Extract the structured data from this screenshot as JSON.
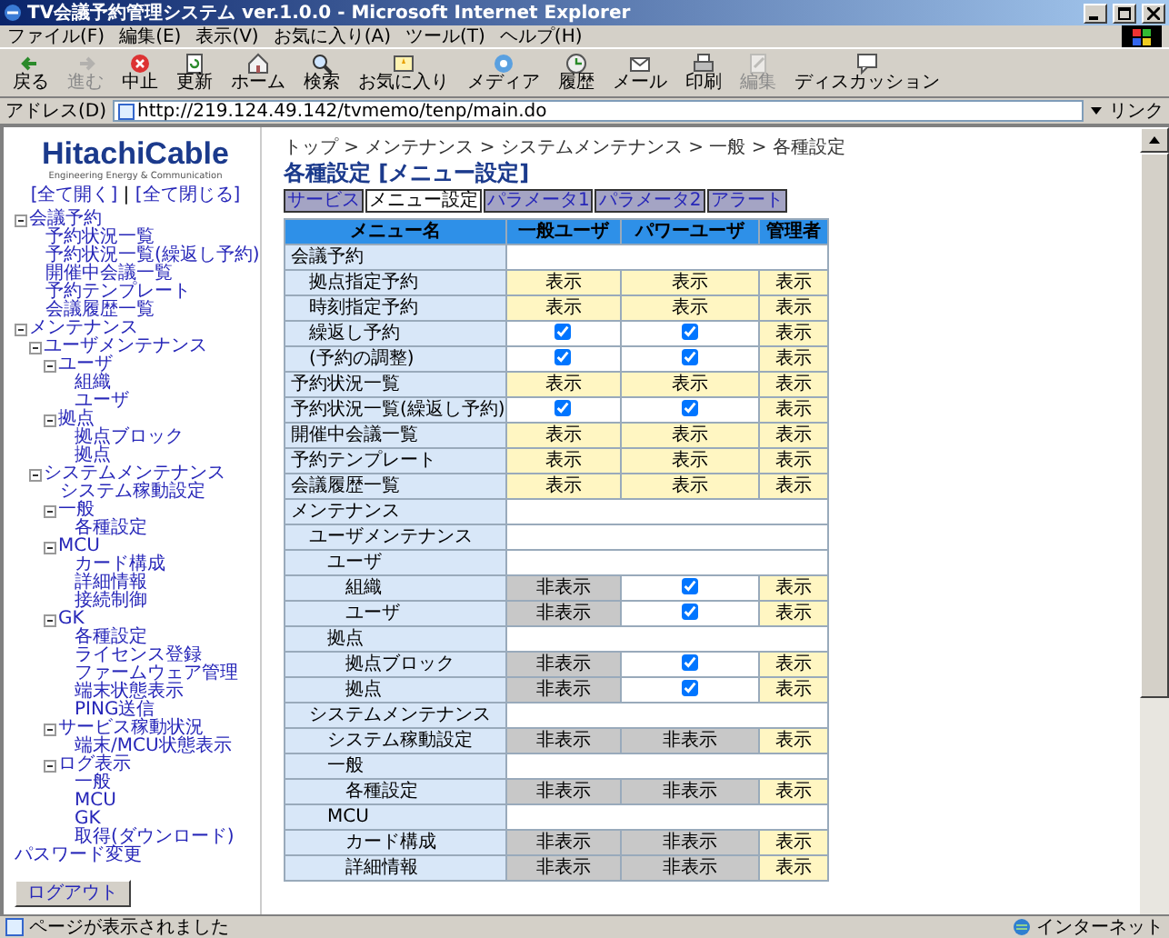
{
  "window": {
    "title": "TV会議予約管理システム ver.1.0.0 - Microsoft Internet Explorer"
  },
  "menu_bar": [
    "ファイル(F)",
    "編集(E)",
    "表示(V)",
    "お気に入り(A)",
    "ツール(T)",
    "ヘルプ(H)"
  ],
  "toolbar": [
    {
      "label": "戻る",
      "kind": "back",
      "disabled": false
    },
    {
      "label": "進む",
      "kind": "forward",
      "disabled": true
    },
    {
      "label": "中止",
      "kind": "stop",
      "disabled": false
    },
    {
      "label": "更新",
      "kind": "refresh",
      "disabled": false
    },
    {
      "label": "ホーム",
      "kind": "home",
      "disabled": false
    },
    {
      "label": "検索",
      "kind": "search",
      "disabled": false
    },
    {
      "label": "お気に入り",
      "kind": "favorites",
      "disabled": false
    },
    {
      "label": "メディア",
      "kind": "media",
      "disabled": false
    },
    {
      "label": "履歴",
      "kind": "history",
      "disabled": false
    },
    {
      "label": "メール",
      "kind": "mail",
      "disabled": false
    },
    {
      "label": "印刷",
      "kind": "print",
      "disabled": false
    },
    {
      "label": "編集",
      "kind": "edit",
      "disabled": true
    },
    {
      "label": "ディスカッション",
      "kind": "discuss",
      "disabled": false
    }
  ],
  "address_bar": {
    "label": "アドレス(D)",
    "url": "http://219.124.49.142/tvmemo/tenp/main.do",
    "links": "リンク"
  },
  "sidebar": {
    "logo": "HitachiCable",
    "tagline": "Engineering Energy & Communication",
    "expand_links": [
      "[全て開く]",
      "[全て閉じる]"
    ],
    "separator": "|",
    "tree": [
      {
        "label": "会議予約",
        "expanded": true,
        "children": [
          {
            "label": "予約状況一覧"
          },
          {
            "label": "予約状況一覧(繰返し予約)"
          },
          {
            "label": "開催中会議一覧"
          },
          {
            "label": "予約テンプレート"
          },
          {
            "label": "会議履歴一覧"
          }
        ]
      },
      {
        "label": "メンテナンス",
        "expanded": true,
        "children": [
          {
            "label": "ユーザメンテナンス",
            "expanded": true,
            "children": [
              {
                "label": "ユーザ",
                "expanded": true,
                "children": [
                  {
                    "label": "組織"
                  },
                  {
                    "label": "ユーザ"
                  }
                ]
              },
              {
                "label": "拠点",
                "expanded": true,
                "children": [
                  {
                    "label": "拠点ブロック"
                  },
                  {
                    "label": "拠点"
                  }
                ]
              }
            ]
          },
          {
            "label": "システムメンテナンス",
            "expanded": true,
            "children": [
              {
                "label": "システム稼動設定"
              },
              {
                "label": "一般",
                "expanded": true,
                "children": [
                  {
                    "label": "各種設定"
                  }
                ]
              },
              {
                "label": "MCU",
                "expanded": true,
                "children": [
                  {
                    "label": "カード構成"
                  },
                  {
                    "label": "詳細情報"
                  },
                  {
                    "label": "接続制御"
                  }
                ]
              },
              {
                "label": "GK",
                "expanded": true,
                "children": [
                  {
                    "label": "各種設定"
                  },
                  {
                    "label": "ライセンス登録"
                  },
                  {
                    "label": "ファームウェア管理"
                  },
                  {
                    "label": "端末状態表示"
                  },
                  {
                    "label": "PING送信"
                  }
                ]
              },
              {
                "label": "サービス稼動状況",
                "expanded": true,
                "children": [
                  {
                    "label": "端末/MCU状態表示"
                  }
                ]
              },
              {
                "label": "ログ表示",
                "expanded": true,
                "children": [
                  {
                    "label": "一般"
                  },
                  {
                    "label": "MCU"
                  },
                  {
                    "label": "GK"
                  },
                  {
                    "label": "取得(ダウンロード)"
                  }
                ]
              }
            ]
          }
        ]
      },
      {
        "label": "パスワード変更"
      }
    ],
    "logout_button": "ログアウト"
  },
  "page": {
    "breadcrumb": "トップ > メンテナンス > システムメンテナンス > 一般 > 各種設定",
    "heading": "各種設定 [メニュー設定]",
    "tabs": [
      {
        "label": "サービス",
        "selected": false
      },
      {
        "label": "メニュー設定",
        "selected": true
      },
      {
        "label": "パラメータ1",
        "selected": false
      },
      {
        "label": "パラメータ2",
        "selected": false
      },
      {
        "label": "アラート",
        "selected": false
      }
    ],
    "table": {
      "columns": [
        "メニュー名",
        "一般ユーザ",
        "パワーユーザ",
        "管理者"
      ],
      "rows": [
        {
          "name": "会議予約",
          "children": [
            {
              "name": "拠点指定予約",
              "cells": [
                {
                  "kind": "shown",
                  "text": "表示"
                },
                {
                  "kind": "shown",
                  "text": "表示"
                },
                {
                  "kind": "shown",
                  "text": "表示"
                }
              ]
            },
            {
              "name": "時刻指定予約",
              "cells": [
                {
                  "kind": "shown",
                  "text": "表示"
                },
                {
                  "kind": "shown",
                  "text": "表示"
                },
                {
                  "kind": "shown",
                  "text": "表示"
                }
              ]
            },
            {
              "name": "繰返し予約",
              "cells": [
                {
                  "kind": "checkbox",
                  "checked": true
                },
                {
                  "kind": "checkbox",
                  "checked": true
                },
                {
                  "kind": "shown",
                  "text": "表示"
                }
              ]
            },
            {
              "name": "(予約の調整)",
              "cells": [
                {
                  "kind": "checkbox",
                  "checked": true
                },
                {
                  "kind": "checkbox",
                  "checked": true
                },
                {
                  "kind": "shown",
                  "text": "表示"
                }
              ]
            }
          ]
        },
        {
          "name": "予約状況一覧",
          "cells": [
            {
              "kind": "shown",
              "text": "表示"
            },
            {
              "kind": "shown",
              "text": "表示"
            },
            {
              "kind": "shown",
              "text": "表示"
            }
          ]
        },
        {
          "name": "予約状況一覧(繰返し予約)",
          "cells": [
            {
              "kind": "checkbox",
              "checked": true
            },
            {
              "kind": "checkbox",
              "checked": true
            },
            {
              "kind": "shown",
              "text": "表示"
            }
          ]
        },
        {
          "name": "開催中会議一覧",
          "cells": [
            {
              "kind": "shown",
              "text": "表示"
            },
            {
              "kind": "shown",
              "text": "表示"
            },
            {
              "kind": "shown",
              "text": "表示"
            }
          ]
        },
        {
          "name": "予約テンプレート",
          "cells": [
            {
              "kind": "shown",
              "text": "表示"
            },
            {
              "kind": "shown",
              "text": "表示"
            },
            {
              "kind": "shown",
              "text": "表示"
            }
          ]
        },
        {
          "name": "会議履歴一覧",
          "cells": [
            {
              "kind": "shown",
              "text": "表示"
            },
            {
              "kind": "shown",
              "text": "表示"
            },
            {
              "kind": "shown",
              "text": "表示"
            }
          ]
        },
        {
          "name": "メンテナンス",
          "children": [
            {
              "name": "ユーザメンテナンス",
              "children": [
                {
                  "name": "ユーザ",
                  "children": [
                    {
                      "name": "組織",
                      "cells": [
                        {
                          "kind": "hidden",
                          "text": "非表示"
                        },
                        {
                          "kind": "checkbox",
                          "checked": true
                        },
                        {
                          "kind": "shown",
                          "text": "表示"
                        }
                      ]
                    },
                    {
                      "name": "ユーザ",
                      "cells": [
                        {
                          "kind": "hidden",
                          "text": "非表示"
                        },
                        {
                          "kind": "checkbox",
                          "checked": true
                        },
                        {
                          "kind": "shown",
                          "text": "表示"
                        }
                      ]
                    }
                  ]
                },
                {
                  "name": "拠点",
                  "children": [
                    {
                      "name": "拠点ブロック",
                      "cells": [
                        {
                          "kind": "hidden",
                          "text": "非表示"
                        },
                        {
                          "kind": "checkbox",
                          "checked": true
                        },
                        {
                          "kind": "shown",
                          "text": "表示"
                        }
                      ]
                    },
                    {
                      "name": "拠点",
                      "cells": [
                        {
                          "kind": "hidden",
                          "text": "非表示"
                        },
                        {
                          "kind": "checkbox",
                          "checked": true
                        },
                        {
                          "kind": "shown",
                          "text": "表示"
                        }
                      ]
                    }
                  ]
                }
              ]
            },
            {
              "name": "システムメンテナンス",
              "children": [
                {
                  "name": "システム稼動設定",
                  "cells": [
                    {
                      "kind": "hidden",
                      "text": "非表示"
                    },
                    {
                      "kind": "hidden",
                      "text": "非表示"
                    },
                    {
                      "kind": "shown",
                      "text": "表示"
                    }
                  ]
                },
                {
                  "name": "一般",
                  "children": [
                    {
                      "name": "各種設定",
                      "cells": [
                        {
                          "kind": "hidden",
                          "text": "非表示"
                        },
                        {
                          "kind": "hidden",
                          "text": "非表示"
                        },
                        {
                          "kind": "shown",
                          "text": "表示"
                        }
                      ]
                    }
                  ]
                },
                {
                  "name": "MCU",
                  "children": [
                    {
                      "name": "カード構成",
                      "cells": [
                        {
                          "kind": "hidden",
                          "text": "非表示"
                        },
                        {
                          "kind": "hidden",
                          "text": "非表示"
                        },
                        {
                          "kind": "shown",
                          "text": "表示"
                        }
                      ]
                    },
                    {
                      "name": "詳細情報",
                      "cells": [
                        {
                          "kind": "hidden",
                          "text": "非表示"
                        },
                        {
                          "kind": "hidden",
                          "text": "非表示"
                        },
                        {
                          "kind": "shown",
                          "text": "表示"
                        }
                      ]
                    }
                  ]
                }
              ]
            }
          ]
        }
      ]
    }
  },
  "status_bar": {
    "text": "ページが表示されました",
    "zone": "インターネット"
  }
}
